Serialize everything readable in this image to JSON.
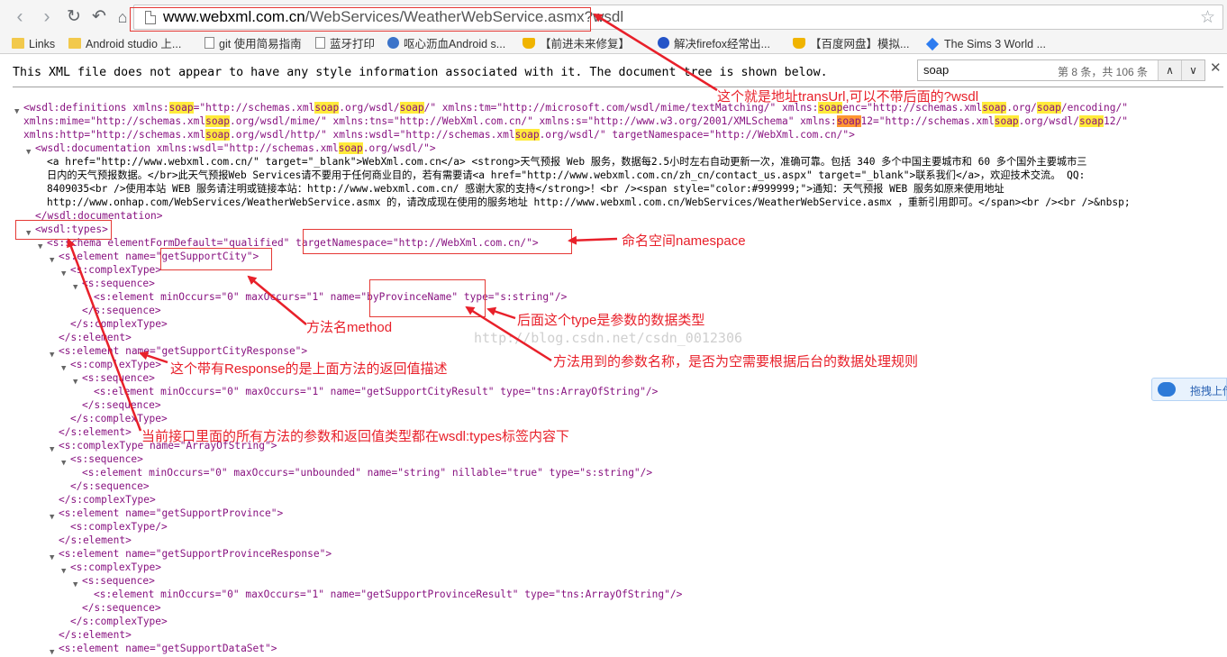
{
  "toolbar": {
    "url_host": "www.webxml.com.cn",
    "url_path": "/WebServices/WeatherWebService.asmx?wsdl"
  },
  "bookmarks": [
    "Links",
    "Android studio 上...",
    "git 使用简易指南",
    "蓝牙打印",
    "呕心沥血Android s...",
    "【前进未来修复】",
    "解决firefox经常出...",
    "【百度网盘】模拟...",
    "The Sims 3 World ..."
  ],
  "notice": "This XML file does not appear to have any style information associated with it. The document tree is shown below.",
  "find": {
    "query": "soap",
    "count": "第 8 条，共 106 条"
  },
  "annotations": {
    "url": "这个就是地址transUrl,可以不带后面的?wsdl",
    "namespace": "命名空间namespace",
    "method": "方法名method",
    "type": "后面这个type是参数的数据类型",
    "response": "这个带有Response的是上面方法的返回值描述",
    "param": "方法用到的参数名称，是否为空需要根据后台的数据处理规则",
    "types": "当前接口里面的所有方法的参数和返回值类型都在wsdl:types标签内容下"
  },
  "watermark": "http://blog.csdn.net/csdn_0012306",
  "side_button": "拖拽上传",
  "xml": {
    "defs_1": "<wsdl:definitions xmlns:soap=\"http://schemas.xmlsoap.org/wsdl/soap/\" xmlns:tm=\"http://microsoft.com/wsdl/mime/textMatching/\" xmlns:soapenc=\"http://schemas.xmlsoap.org/soap/encoding/\"",
    "defs_2": "xmlns:mime=\"http://schemas.xmlsoap.org/wsdl/mime/\" xmlns:tns=\"http://WebXml.com.cn/\" xmlns:s=\"http://www.w3.org/2001/XMLSchema\" xmlns:soap12=\"http://schemas.xmlsoap.org/wsdl/soap12/\"",
    "defs_3": "xmlns:http=\"http://schemas.xmlsoap.org/wsdl/http/\" xmlns:wsdl=\"http://schemas.xmlsoap.org/wsdl/\" targetNamespace=\"http://WebXml.com.cn/\">",
    "doc_open": "<wsdl:documentation xmlns:wsdl=\"http://schemas.xmlsoap.org/wsdl/\">",
    "doc_text_1": "<a href=\"http://www.webxml.com.cn/\" target=\"_blank\">WebXml.com.cn</a> <strong>天气预报 Web 服务，数据每2.5小时左右自动更新一次，准确可靠。包括 340 多个中国主要城市和 60 多个国外主要城市三",
    "doc_text_2": "日内的天气预报数据。</br>此天气预报Web Services请不要用于任何商业目的，若有需要请<a href=\"http://www.webxml.com.cn/zh_cn/contact_us.aspx\" target=\"_blank\">联系我们</a>，欢迎技术交流。 QQ:",
    "doc_text_3": "8409035<br />使用本站 WEB 服务请注明或链接本站：http://www.webxml.com.cn/ 感谢大家的支持</strong>！<br /><span style=\"color:#999999;\">通知：天气预报 WEB 服务如原来使用地址",
    "doc_text_4": "http://www.onhap.com/WebServices/WeatherWebService.asmx 的，请改成现在使用的服务地址 http://www.webxml.com.cn/WebServices/WeatherWebService.asmx ，重新引用即可。</span><br /><br />&nbsp;",
    "doc_close": "</wsdl:documentation>",
    "types_open": "<wsdl:types>",
    "schema_open": "<s:schema elementFormDefault=\"qualified\" targetNamespace=\"http://WebXml.com.cn/\">",
    "el_city": "<s:element name=\"getSupportCity\">",
    "ct_open": "<s:complexType>",
    "seq_open": "<s:sequence>",
    "el_province_name": "<s:element minOccurs=\"0\" maxOccurs=\"1\" name=\"byProvinceName\" type=\"s:string\"/>",
    "seq_close": "</s:sequence>",
    "ct_close": "</s:complexType>",
    "el_close": "</s:element>",
    "el_city_resp": "<s:element name=\"getSupportCityResponse\">",
    "el_city_result": "<s:element minOccurs=\"0\" maxOccurs=\"1\" name=\"getSupportCityResult\" type=\"tns:ArrayOfString\"/>",
    "ct_array": "<s:complexType name=\"ArrayOfString\">",
    "el_string": "<s:element minOccurs=\"0\" maxOccurs=\"unbounded\" name=\"string\" nillable=\"true\" type=\"s:string\"/>",
    "el_province": "<s:element name=\"getSupportProvince\">",
    "ct_empty": "<s:complexType/>",
    "el_province_resp": "<s:element name=\"getSupportProvinceResponse\">",
    "el_province_result": "<s:element minOccurs=\"0\" maxOccurs=\"1\" name=\"getSupportProvinceResult\" type=\"tns:ArrayOfString\"/>",
    "el_dataset": "<s:element name=\"getSupportDataSet\">"
  }
}
